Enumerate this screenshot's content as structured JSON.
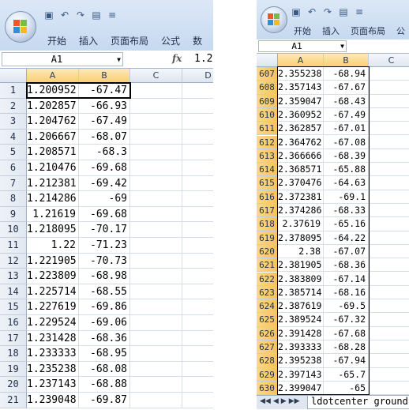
{
  "left": {
    "menu": [
      "开始",
      "插入",
      "页面布局",
      "公式",
      "数"
    ],
    "name_box": "A1",
    "formula_value": "1.2",
    "columns": [
      "A",
      "B",
      "C",
      "D"
    ],
    "rows": [
      {
        "n": "1",
        "a": "1.200952",
        "b": "-67.47"
      },
      {
        "n": "2",
        "a": "1.202857",
        "b": "-66.93"
      },
      {
        "n": "3",
        "a": "1.204762",
        "b": "-67.49"
      },
      {
        "n": "4",
        "a": "1.206667",
        "b": "-68.07"
      },
      {
        "n": "5",
        "a": "1.208571",
        "b": "-68.3"
      },
      {
        "n": "6",
        "a": "1.210476",
        "b": "-69.68"
      },
      {
        "n": "7",
        "a": "1.212381",
        "b": "-69.42"
      },
      {
        "n": "8",
        "a": "1.214286",
        "b": "-69"
      },
      {
        "n": "9",
        "a": "1.21619",
        "b": "-69.68"
      },
      {
        "n": "10",
        "a": "1.218095",
        "b": "-70.17"
      },
      {
        "n": "11",
        "a": "1.22",
        "b": "-71.23"
      },
      {
        "n": "12",
        "a": "1.221905",
        "b": "-70.73"
      },
      {
        "n": "13",
        "a": "1.223809",
        "b": "-68.98"
      },
      {
        "n": "14",
        "a": "1.225714",
        "b": "-68.55"
      },
      {
        "n": "15",
        "a": "1.227619",
        "b": "-69.86"
      },
      {
        "n": "16",
        "a": "1.229524",
        "b": "-69.06"
      },
      {
        "n": "17",
        "a": "1.231428",
        "b": "-68.36"
      },
      {
        "n": "18",
        "a": "1.233333",
        "b": "-68.95"
      },
      {
        "n": "19",
        "a": "1.235238",
        "b": "-68.08"
      },
      {
        "n": "20",
        "a": "1.237143",
        "b": "-68.88"
      },
      {
        "n": "21",
        "a": "1.239048",
        "b": "-69.87"
      }
    ]
  },
  "right": {
    "menu": [
      "开始",
      "插入",
      "页面布局",
      "公"
    ],
    "name_box": "A1",
    "columns": [
      "A",
      "B",
      "C"
    ],
    "rows": [
      {
        "n": "607",
        "a": "2.355238",
        "b": "-68.94"
      },
      {
        "n": "608",
        "a": "2.357143",
        "b": "-67.67"
      },
      {
        "n": "609",
        "a": "2.359047",
        "b": "-68.43"
      },
      {
        "n": "610",
        "a": "2.360952",
        "b": "-67.49"
      },
      {
        "n": "611",
        "a": "2.362857",
        "b": "-67.01"
      },
      {
        "n": "612",
        "a": "2.364762",
        "b": "-67.08"
      },
      {
        "n": "613",
        "a": "2.366666",
        "b": "-68.39"
      },
      {
        "n": "614",
        "a": "2.368571",
        "b": "-65.88"
      },
      {
        "n": "615",
        "a": "2.370476",
        "b": "-64.63"
      },
      {
        "n": "616",
        "a": "2.372381",
        "b": "-69.1"
      },
      {
        "n": "617",
        "a": "2.374286",
        "b": "-68.33"
      },
      {
        "n": "618",
        "a": "2.37619",
        "b": "-65.16"
      },
      {
        "n": "619",
        "a": "2.378095",
        "b": "-64.22"
      },
      {
        "n": "620",
        "a": "2.38",
        "b": "-67.07"
      },
      {
        "n": "621",
        "a": "2.381905",
        "b": "-68.36"
      },
      {
        "n": "622",
        "a": "2.383809",
        "b": "-67.14"
      },
      {
        "n": "623",
        "a": "2.385714",
        "b": "-68.16"
      },
      {
        "n": "624",
        "a": "2.387619",
        "b": "-69.5"
      },
      {
        "n": "625",
        "a": "2.389524",
        "b": "-67.32"
      },
      {
        "n": "626",
        "a": "2.391428",
        "b": "-67.68"
      },
      {
        "n": "627",
        "a": "2.393333",
        "b": "-68.28"
      },
      {
        "n": "628",
        "a": "2.395238",
        "b": "-67.94"
      },
      {
        "n": "629",
        "a": "2.397143",
        "b": "-65.7"
      },
      {
        "n": "630",
        "a": "2.399047",
        "b": "-65"
      }
    ],
    "sheet_tab": "ldotcenter ground"
  },
  "icons": {
    "office_button": "office-logo-icon",
    "save": "save-icon",
    "undo": "undo-icon",
    "redo": "redo-icon",
    "print_preview": "print-preview-icon",
    "qat_more": "qat-dropdown-icon",
    "fx": "fx-icon"
  },
  "colors": {
    "ribbon": "#c6d9f0",
    "selected_header": "#f6c25b",
    "grid_line": "#d7dde6"
  }
}
